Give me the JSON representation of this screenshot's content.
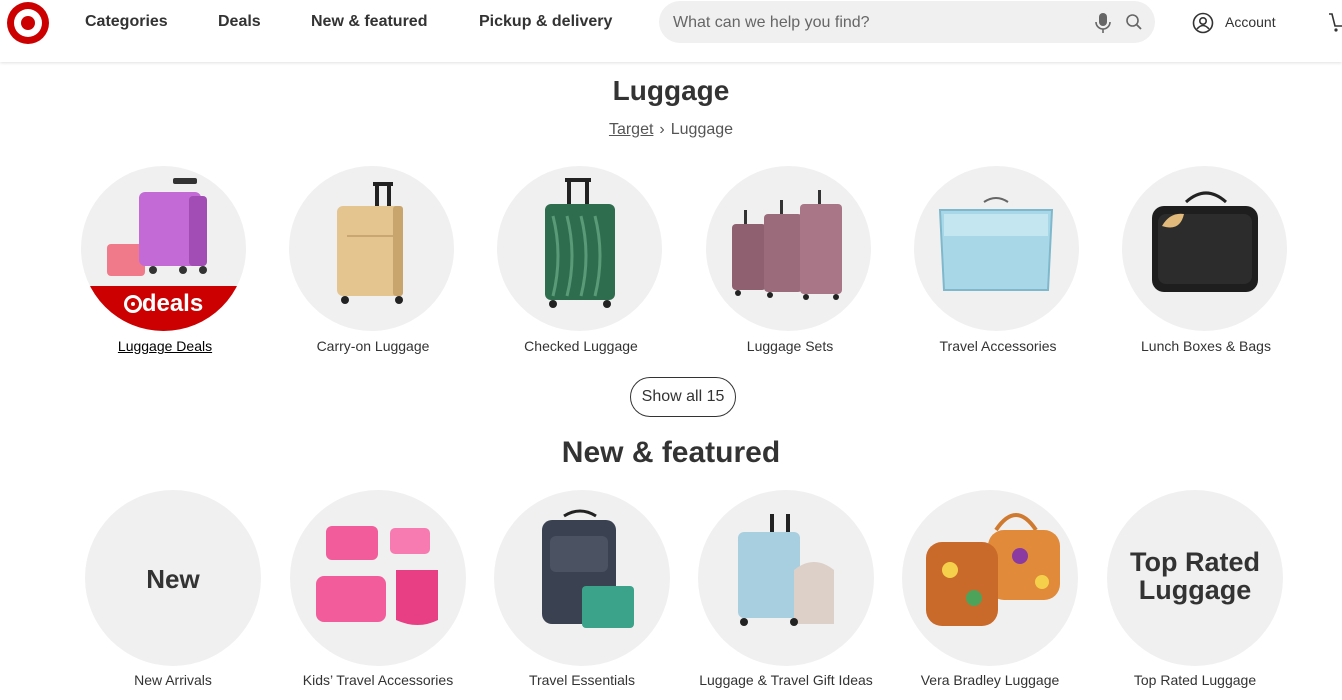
{
  "header": {
    "nav": [
      "Categories",
      "Deals",
      "New & featured",
      "Pickup & delivery"
    ],
    "search_placeholder": "What can we help you find?",
    "account_label": "Account"
  },
  "page": {
    "title": "Luggage",
    "breadcrumb": {
      "root": "Target",
      "current": "Luggage"
    }
  },
  "categories": [
    {
      "label": "Luggage Deals",
      "badge": "deals"
    },
    {
      "label": "Carry-on Luggage"
    },
    {
      "label": "Checked Luggage"
    },
    {
      "label": "Luggage Sets"
    },
    {
      "label": "Travel Accessories"
    },
    {
      "label": "Lunch Boxes & Bags"
    }
  ],
  "show_all_label": "Show all 15",
  "featured": {
    "title": "New & featured",
    "items": [
      {
        "label": "New Arrivals",
        "circle_text": "New"
      },
      {
        "label": "Kids’ Travel Accessories"
      },
      {
        "label": "Travel Essentials"
      },
      {
        "label": "Luggage & Travel Gift Ideas"
      },
      {
        "label": "Vera Bradley Luggage"
      },
      {
        "label": "Top Rated Luggage",
        "circle_text": "Top Rated Luggage"
      }
    ]
  },
  "colors": {
    "brand_red": "#cc0000",
    "circle_bg": "#f0f0f0"
  }
}
